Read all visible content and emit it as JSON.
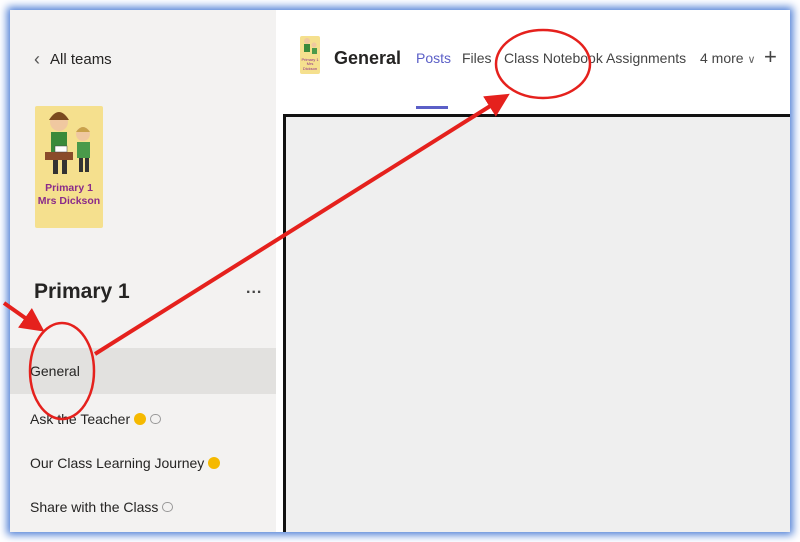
{
  "sidebar": {
    "back_label": "All teams",
    "avatar_text": [
      "Primary 1",
      "Mrs Dickson"
    ],
    "team_name": "Primary 1",
    "more_label": "...",
    "channels": [
      {
        "label": "General",
        "active": true
      },
      {
        "label": "Ask the Teacher",
        "icons": [
          "thinking-face-emoji-icon",
          "chat-bubble-icon"
        ]
      },
      {
        "label": "Our Class Learning Journey",
        "icons": [
          "smiling-face-emoji-icon"
        ]
      },
      {
        "label": "Share with the Class",
        "icons": [
          "chat-bubble-icon"
        ]
      }
    ]
  },
  "header": {
    "channel_title": "General",
    "avatar_text": [
      "Primary 1",
      "Mrs Dickson"
    ],
    "tabs": [
      {
        "label": "Posts",
        "active": true
      },
      {
        "label": "Files"
      },
      {
        "label": "Class Notebook"
      },
      {
        "label": "Assignments"
      },
      {
        "label": "4 more"
      }
    ],
    "add_tab_label": "+"
  },
  "colors": {
    "accent": "#5b5fc7",
    "annotation_red": "#e5211d",
    "frame_glow": "#4f7fd6"
  }
}
